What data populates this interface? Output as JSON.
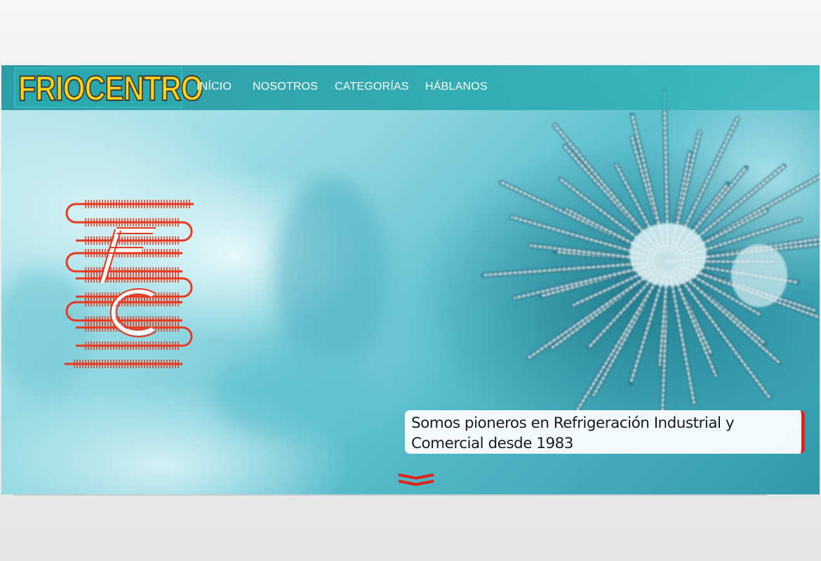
{
  "brand": {
    "name": "FRIOCENTRO"
  },
  "nav": {
    "items": [
      {
        "label": "INÍCIO"
      },
      {
        "label": "NOSOTROS"
      },
      {
        "label": "CATEGORÍAS"
      },
      {
        "label": "HÁBLANOS"
      }
    ]
  },
  "hero": {
    "logo_icon": "fc-monogram-coil-icon",
    "tagline": "Somos pioneros en Refrigeración Industrial y Comercial desde 1983",
    "scroll_icon": "chevron-down-icon"
  },
  "colors": {
    "navbar": "#2aa8ad",
    "brand_text": "#ffd21a",
    "accent_red": "#e2231a",
    "hero_teal": "#57bccb"
  }
}
